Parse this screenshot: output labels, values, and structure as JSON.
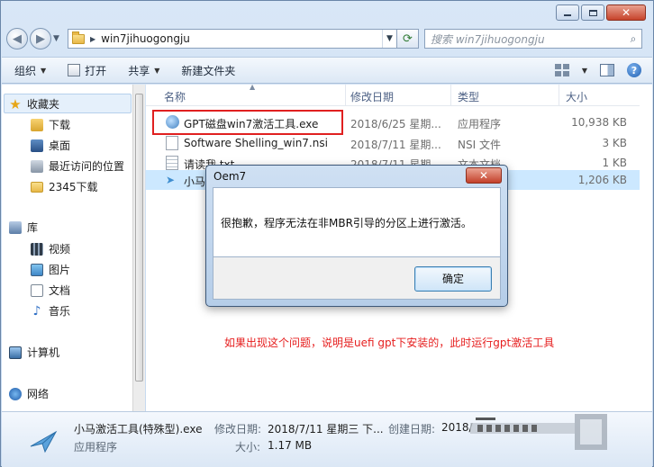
{
  "window": {
    "address_path": "win7jihuogongju",
    "search_placeholder": "搜索 win7jihuogongju"
  },
  "toolbar": {
    "organize": "组织",
    "open": "打开",
    "share": "共享",
    "new_folder": "新建文件夹"
  },
  "sidebar": {
    "favorites": "收藏夹",
    "downloads": "下载",
    "desktop": "桌面",
    "recent": "最近访问的位置",
    "dl2345": "2345下载",
    "libraries": "库",
    "videos": "视频",
    "pictures": "图片",
    "documents": "文档",
    "music": "音乐",
    "computer": "计算机",
    "network": "网络"
  },
  "columns": {
    "name": "名称",
    "date": "修改日期",
    "type": "类型",
    "size": "大小"
  },
  "files": [
    {
      "name": "GPT磁盘win7激活工具.exe",
      "date": "2018/6/25 星期...",
      "type": "应用程序",
      "size": "10,938 KB"
    },
    {
      "name": "Software Shelling_win7.nsi",
      "date": "2018/7/11 星期...",
      "type": "NSI 文件",
      "size": "3 KB"
    },
    {
      "name": "请读我.txt",
      "date": "2018/7/11 星期...",
      "type": "文本文档",
      "size": "1 KB"
    },
    {
      "name": "小马",
      "date": "",
      "type": "",
      "size": "1,206 KB"
    }
  ],
  "annotation": "如果出现这个问题，说明是uefi gpt下安装的，此时运行gpt激活工具",
  "details": {
    "name": "小马激活工具(特殊型).exe",
    "type": "应用程序",
    "modified_label": "修改日期:",
    "modified_value": "2018/7/11 星期三 下...",
    "created_label": "创建日期:",
    "created_value": "2018/",
    "size_label": "大小:",
    "size_value": "1.17 MB"
  },
  "dialog": {
    "title": "Oem7",
    "close": "✕",
    "message": "很抱歉，程序无法在非MBR引导的分区上进行激活。",
    "ok": "确定"
  },
  "colors": {
    "annotation_red": "#e61e1e",
    "selection_blue": "#cce8ff"
  }
}
